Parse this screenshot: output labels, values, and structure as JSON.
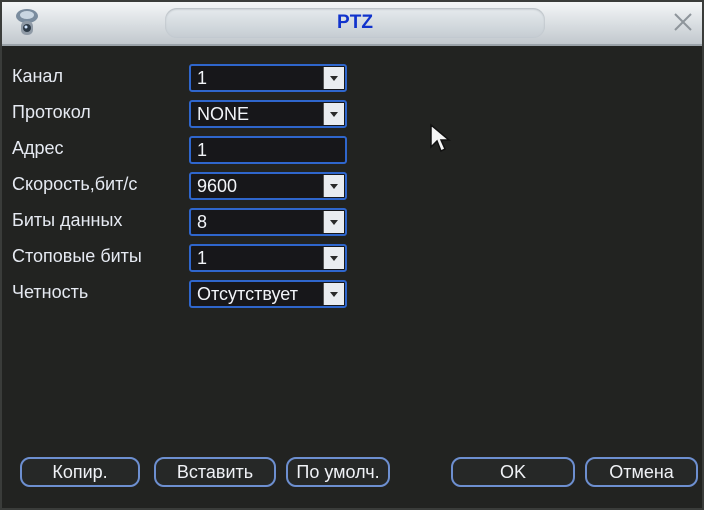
{
  "window": {
    "title": "PTZ"
  },
  "form": {
    "fields": [
      {
        "label": "Канал",
        "value": "1",
        "type": "select"
      },
      {
        "label": "Протокол",
        "value": "NONE",
        "type": "select"
      },
      {
        "label": "Адрес",
        "value": "1",
        "type": "input"
      },
      {
        "label": "Скорость,бит/с",
        "value": "9600",
        "type": "select"
      },
      {
        "label": "Биты данных",
        "value": "8",
        "type": "select"
      },
      {
        "label": "Стоповые биты",
        "value": "1",
        "type": "select"
      },
      {
        "label": "Четность",
        "value": "Отсутствует",
        "type": "select"
      }
    ]
  },
  "buttons": {
    "copy": "Копир.",
    "paste": "Вставить",
    "default": "По умолч.",
    "ok": "OK",
    "cancel": "Отмена"
  },
  "colors": {
    "accent": "#2f66cc",
    "title": "#1133cc",
    "background": "#222321"
  }
}
